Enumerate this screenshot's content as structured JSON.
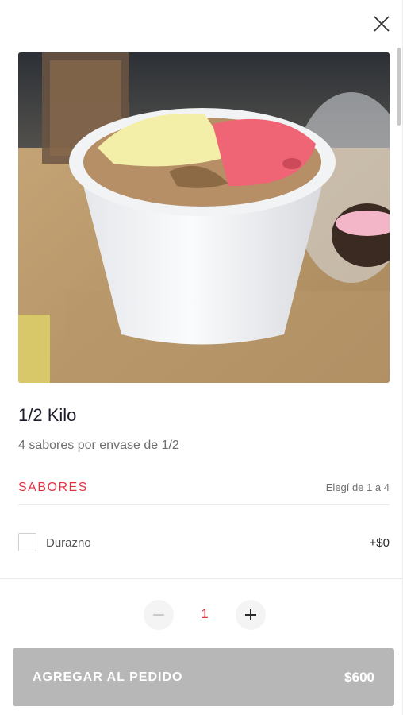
{
  "product": {
    "title": "1/2 Kilo",
    "description": "4 sabores por envase de 1/2",
    "image_alt": "ice-cream-cup-photo"
  },
  "flavors_section": {
    "title": "SABORES",
    "hint": "Elegí de 1 a 4",
    "options": [
      {
        "label": "Durazno",
        "price": "+$0",
        "checked": false
      }
    ]
  },
  "quantity": {
    "value": "1"
  },
  "add_button": {
    "label": "AGREGAR AL PEDIDO",
    "price": "$600"
  },
  "icons": {
    "close": "close-icon",
    "minus": "minus-icon",
    "plus": "plus-icon"
  },
  "colors": {
    "accent": "#e0323f",
    "button_disabled": "#b7b7b7",
    "text_primary": "#1b1b2a",
    "text_secondary": "#6f6f6f"
  }
}
